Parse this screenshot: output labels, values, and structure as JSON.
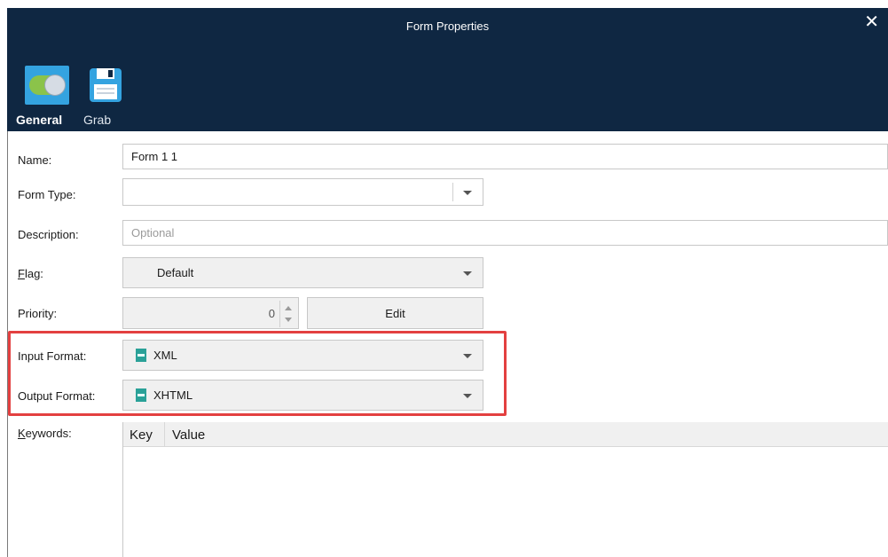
{
  "window": {
    "title": "Form Properties",
    "close_symbol": "✕"
  },
  "toolbar": {
    "general_label": "General",
    "grab_label": "Grab",
    "icons": [
      "toggle-icon",
      "save-icon"
    ]
  },
  "form": {
    "name": {
      "label": "Name:",
      "value": "Form 1 1"
    },
    "form_type": {
      "label": "Form Type:",
      "value": ""
    },
    "description": {
      "label": "Description:",
      "placeholder": "Optional"
    },
    "flag": {
      "label": "Flag:",
      "value": "Default"
    },
    "priority": {
      "label": "Priority:",
      "value": "0",
      "edit_label": "Edit"
    },
    "input_format": {
      "label": "Input Format:",
      "value": "XML"
    },
    "output_format": {
      "label": "Output Format:",
      "value": "XHTML"
    },
    "keywords": {
      "label": "Keywords:",
      "columns": [
        "Key",
        "Value"
      ]
    }
  },
  "colors": {
    "titlebar": "#0f2742",
    "highlight": "#e34040",
    "toggle_bg": "#34a3e0",
    "toggle_track": "#8bc34a",
    "file_icon": "#2aa198"
  }
}
